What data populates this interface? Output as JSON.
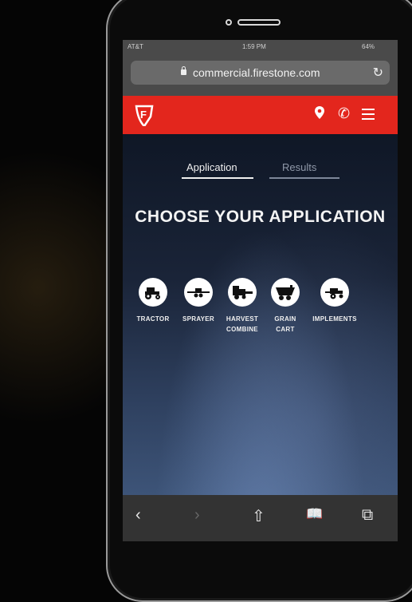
{
  "status": {
    "carrier": "AT&T",
    "time": "1:59 PM",
    "battery": "64%"
  },
  "browser": {
    "url": "commercial.firestone.com"
  },
  "header": {
    "brand": "F"
  },
  "tabs": [
    {
      "label": "Application",
      "active": true
    },
    {
      "label": "Results",
      "active": false
    }
  ],
  "heading": "CHOOSE YOUR APPLICATION",
  "applications": [
    {
      "line1": "TRACTOR",
      "line2": "",
      "icon": "tractor-icon"
    },
    {
      "line1": "SPRAYER",
      "line2": "",
      "icon": "sprayer-icon"
    },
    {
      "line1": "HARVEST",
      "line2": "COMBINE",
      "icon": "combine-icon"
    },
    {
      "line1": "GRAIN",
      "line2": "CART",
      "icon": "grain-cart-icon"
    },
    {
      "line1": "IMPLEMENTS",
      "line2": "",
      "icon": "implements-icon"
    }
  ],
  "toolbar": {
    "back": "‹",
    "forward": "›",
    "share": "⇧",
    "bookmarks": "📖",
    "tabs": "⧉"
  },
  "colors": {
    "brand_red": "#e3261d",
    "chrome_gray": "#4a4a4a"
  }
}
